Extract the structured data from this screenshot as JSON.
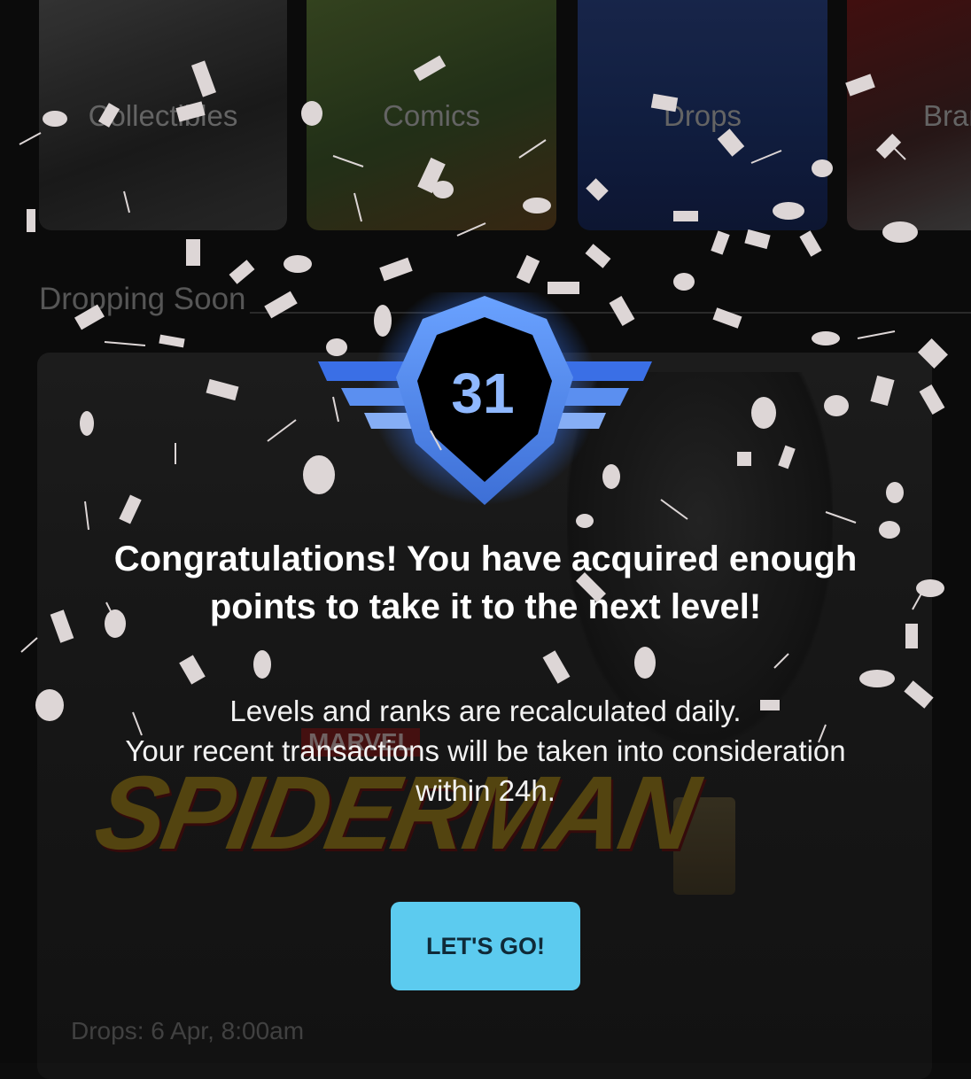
{
  "categories": [
    {
      "label": "Collectibles"
    },
    {
      "label": "Comics"
    },
    {
      "label": "Drops"
    },
    {
      "label": "Brands"
    }
  ],
  "section_title": "Dropping Soon",
  "drop_card": {
    "brand_tag": "MARVEL",
    "title": "SPIDERMAN",
    "date": "Drops: 6 Apr, 8:00am"
  },
  "modal": {
    "level": "31",
    "headline_line1": "Congratulations! You have acquired enough",
    "headline_line2": "points to take it to the next level!",
    "info_line1": "Levels and ranks are recalculated daily.",
    "info_line2": "Your recent transactions will be taken into consideration",
    "info_line3": "within 24h.",
    "button_label": "LET'S GO!"
  },
  "colors": {
    "accent": "#5ccbef",
    "badge_blue": "#4a86e8",
    "confetti": "#ddd6d6"
  }
}
